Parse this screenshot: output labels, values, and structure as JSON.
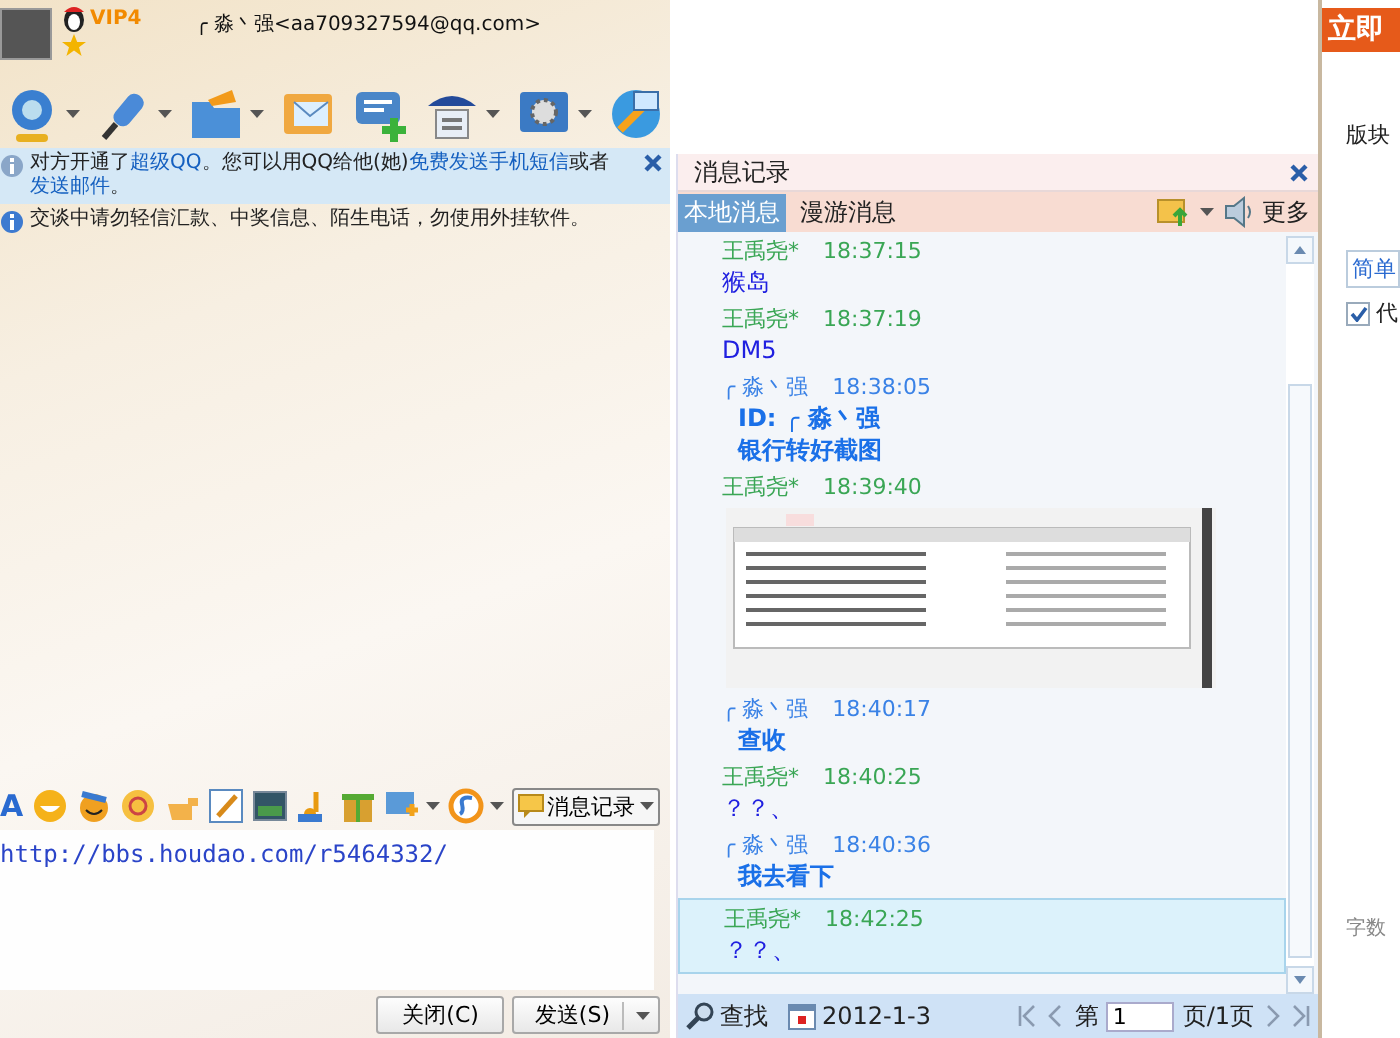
{
  "chat_window": {
    "contact": {
      "name": "╭ 淼丶强<aa709327594@qq.com>",
      "vip": "VIP4"
    },
    "notices": [
      {
        "kind": "info",
        "segments": [
          {
            "text": "对方开通了",
            "link": false
          },
          {
            "text": "超级QQ",
            "link": true
          },
          {
            "text": "。您可以用QQ给他(她)",
            "link": false
          },
          {
            "text": "免费发送手机短信",
            "link": true
          },
          {
            "text": "或者",
            "link": false
          },
          {
            "text": "发送邮件",
            "link": true
          },
          {
            "text": "。",
            "link": false
          }
        ]
      },
      {
        "kind": "warning",
        "segments": [
          {
            "text": "交谈中请勿轻信汇款、中奖信息、陌生电话，勿使用外挂软件。",
            "link": false
          }
        ]
      }
    ],
    "format_toolbar": {
      "font": "A",
      "history_button": "消息记录"
    },
    "input": {
      "value": "http://bbs.houdao.com/r5464332/"
    },
    "buttons": [
      {
        "label": "关闭(C)",
        "split": false
      },
      {
        "label": "发送(S)",
        "split": true
      }
    ]
  },
  "history": {
    "title": "消息记录",
    "tabs": [
      {
        "label": "本地消息",
        "selected": true
      },
      {
        "label": "漫游消息",
        "selected": false
      }
    ],
    "more": "更多",
    "messages": [
      {
        "kind": "text",
        "sender": "王禹尧*",
        "time": "18:37:15",
        "color": "#3aa655",
        "bold": false,
        "selected": false,
        "lines": [
          "猴岛"
        ]
      },
      {
        "kind": "text",
        "sender": "王禹尧*",
        "time": "18:37:19",
        "color": "#3aa655",
        "bold": false,
        "selected": false,
        "lines": [
          "DM5"
        ]
      },
      {
        "kind": "text",
        "sender": "╭ 淼丶强",
        "time": "18:38:05",
        "color": "#3a82e6",
        "bold": true,
        "selected": false,
        "lines": [
          "ID:  ╭ 淼丶强",
          "银行转好截图"
        ]
      },
      {
        "kind": "image",
        "sender": "王禹尧*",
        "time": "18:39:40",
        "color": "#3aa655",
        "selected": false
      },
      {
        "kind": "text",
        "sender": "╭ 淼丶强",
        "time": "18:40:17",
        "color": "#3a82e6",
        "bold": true,
        "selected": false,
        "lines": [
          "查收"
        ]
      },
      {
        "kind": "text",
        "sender": "王禹尧*",
        "time": "18:40:25",
        "color": "#3aa655",
        "bold": false,
        "selected": false,
        "lines": [
          "？？、"
        ]
      },
      {
        "kind": "text",
        "sender": "╭ 淼丶强",
        "time": "18:40:36",
        "color": "#3a82e6",
        "bold": true,
        "selected": false,
        "lines": [
          "我去看下"
        ]
      },
      {
        "kind": "text",
        "sender": "王禹尧*",
        "time": "18:42:25",
        "color": "#3aa655",
        "bold": false,
        "selected": true,
        "lines": [
          "？？、"
        ]
      }
    ],
    "footer": {
      "search": "查找",
      "date": "2012-1-3",
      "page_prefix": "第",
      "page": "1",
      "page_suffix": "页/1页"
    }
  },
  "side_page": {
    "banner": "立即",
    "label": "版块",
    "tab": "简单",
    "option": {
      "label": "代",
      "checked": true
    },
    "counter": "字数"
  }
}
